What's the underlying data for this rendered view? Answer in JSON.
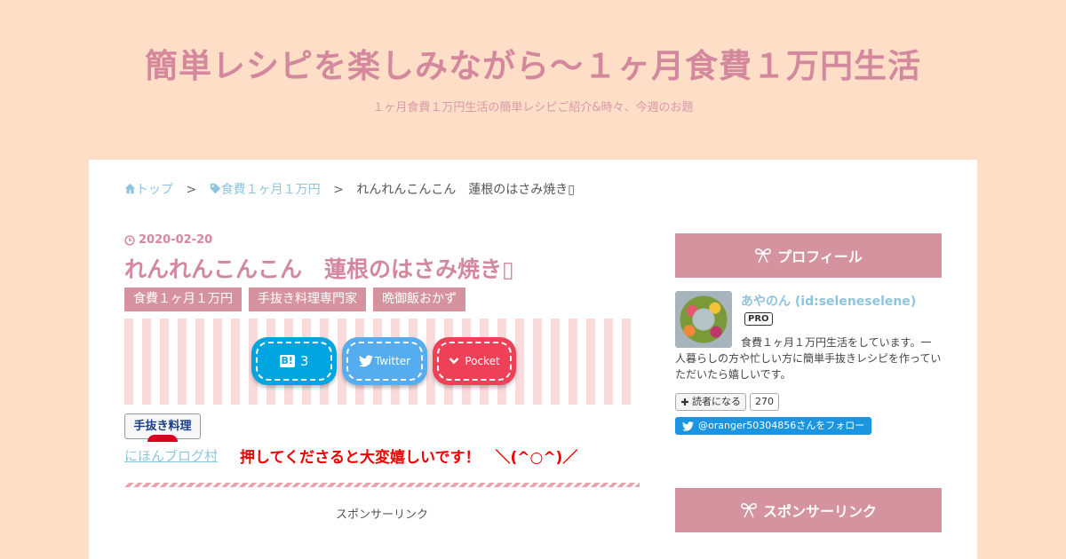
{
  "header": {
    "site_title": "簡単レシピを楽しみながら〜１ヶ月食費１万円生活",
    "site_description": "１ヶ月食費１万円生活の簡単レシピご紹介&時々、今週のお題"
  },
  "breadcrumb": {
    "top": "トップ",
    "sep1": ">",
    "category": "食費１ヶ月１万円",
    "sep2": ">",
    "current": "れんれんこんこん　蓮根のはさみ焼き▯"
  },
  "entry": {
    "date": "2020-02-20",
    "title": "れんれんこんこん　蓮根のはさみ焼き▯",
    "tags": [
      "食費１ヶ月１万円",
      "手抜き料理専門家",
      "晩御飯おかず"
    ]
  },
  "share": {
    "hatena_logo": "B!",
    "hatena_count": "3",
    "twitter_label": "Twitter",
    "pocket_label": "Pocket"
  },
  "banner": {
    "image_text": "手抜き料理",
    "blog_mura_link": "にほんブログ村",
    "push_message": "押してくださると大変嬉しいです！　＼(^○^)／"
  },
  "sponsor_label_main": "スポンサーリンク",
  "sidebar": {
    "profile_heading": "プロフィール",
    "profile_name": "あやのん (id:seleneselene)",
    "pro_badge": "PRO",
    "profile_description": "食費１ヶ月１万円生活をしています。一人暮らしの方や忙しい方に簡単手抜きレシピを作っていただいたら嬉しいです。",
    "reader_button": "読者になる",
    "reader_count": "270",
    "twitter_follow": "@oranger50304856さんをフォロー",
    "sponsor_heading": "スポンサーリンク"
  },
  "colors": {
    "background": "#ffdec7",
    "accent_pink": "#d3889d",
    "tag_pink": "#d5939f",
    "link_blue": "#8ec5dc",
    "hatena_blue": "#00a4de",
    "twitter_blue": "#55acee",
    "pocket_red": "#ee4056"
  }
}
